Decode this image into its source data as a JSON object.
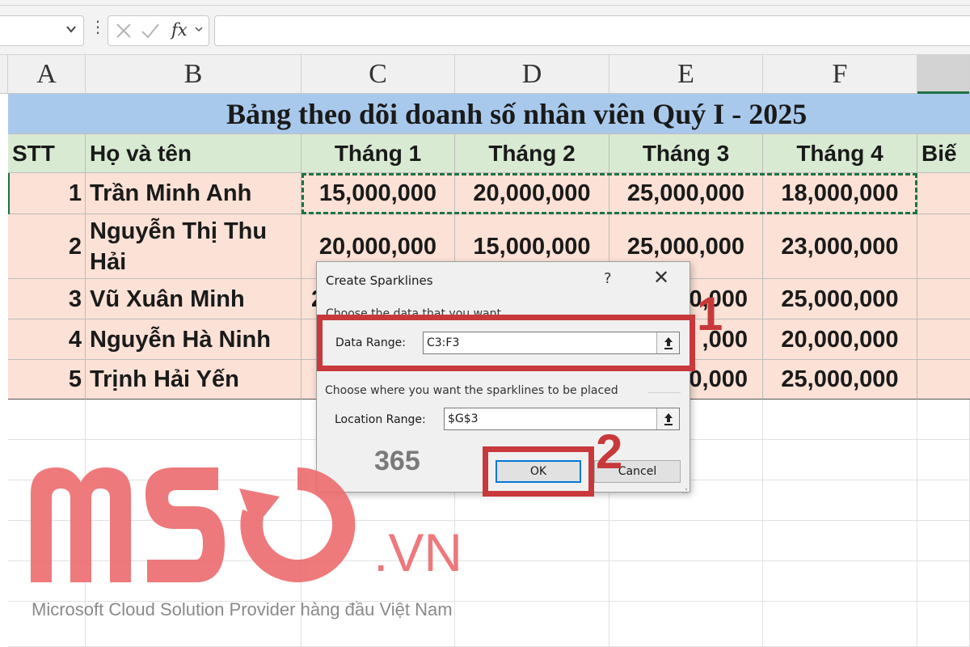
{
  "formula_bar": {
    "fx_label": "fx",
    "chevron": "⌄",
    "dots": "⋮"
  },
  "columns": [
    "A",
    "B",
    "C",
    "D",
    "E",
    "F",
    ""
  ],
  "sheet": {
    "title": "Bảng theo dõi doanh số nhân viên Quý I - 2025",
    "headers": [
      "STT",
      "Họ và tên",
      "Tháng 1",
      "Tháng 2",
      "Tháng 3",
      "Tháng 4",
      "Biế"
    ],
    "rows": [
      {
        "stt": "1",
        "name": "Trần Minh Anh",
        "name2": "",
        "m1": "15,000,000",
        "m2": "20,000,000",
        "m3": "25,000,000",
        "m4": "18,000,000"
      },
      {
        "stt": "2",
        "name": "Nguyễn Thị Thu",
        "name2": "Hải",
        "m1": "20,000,000",
        "m2": "15,000,000",
        "m3": "25,000,000",
        "m4": "23,000,000"
      },
      {
        "stt": "3",
        "name": "Vũ Xuân Minh",
        "name2": "",
        "m1": "2",
        "m2": "",
        "m3": "0,000",
        "m4": "25,000,000"
      },
      {
        "stt": "4",
        "name": "Nguyễn Hà Ninh",
        "name2": "",
        "m1": "",
        "m2": "",
        "m3": ",000",
        "m4": "20,000,000"
      },
      {
        "stt": "5",
        "name": "Trịnh Hải Yến",
        "name2": "",
        "m1": "",
        "m2": "",
        "m3": "0,000",
        "m4": "25,000,000"
      }
    ]
  },
  "dialog": {
    "title": "Create Sparklines",
    "help": "?",
    "close": "✕",
    "section1": "Choose the data that you want",
    "data_range_label": "Data Range:",
    "data_range_value": "C3:F3",
    "section2": "Choose where you want the sparklines to be placed",
    "location_range_label": "Location Range:",
    "location_range_value": "$G$3",
    "ok": "OK",
    "cancel": "Cancel",
    "badge": "365"
  },
  "annotations": {
    "step1": "1",
    "step2": "2",
    "color": "#c8393b"
  },
  "watermark": {
    "brand": "MSO",
    "domain": ".VN",
    "tagline": "Microsoft Cloud Solution Provider hàng đầu Việt Nam",
    "color": "#ec6b6e"
  }
}
